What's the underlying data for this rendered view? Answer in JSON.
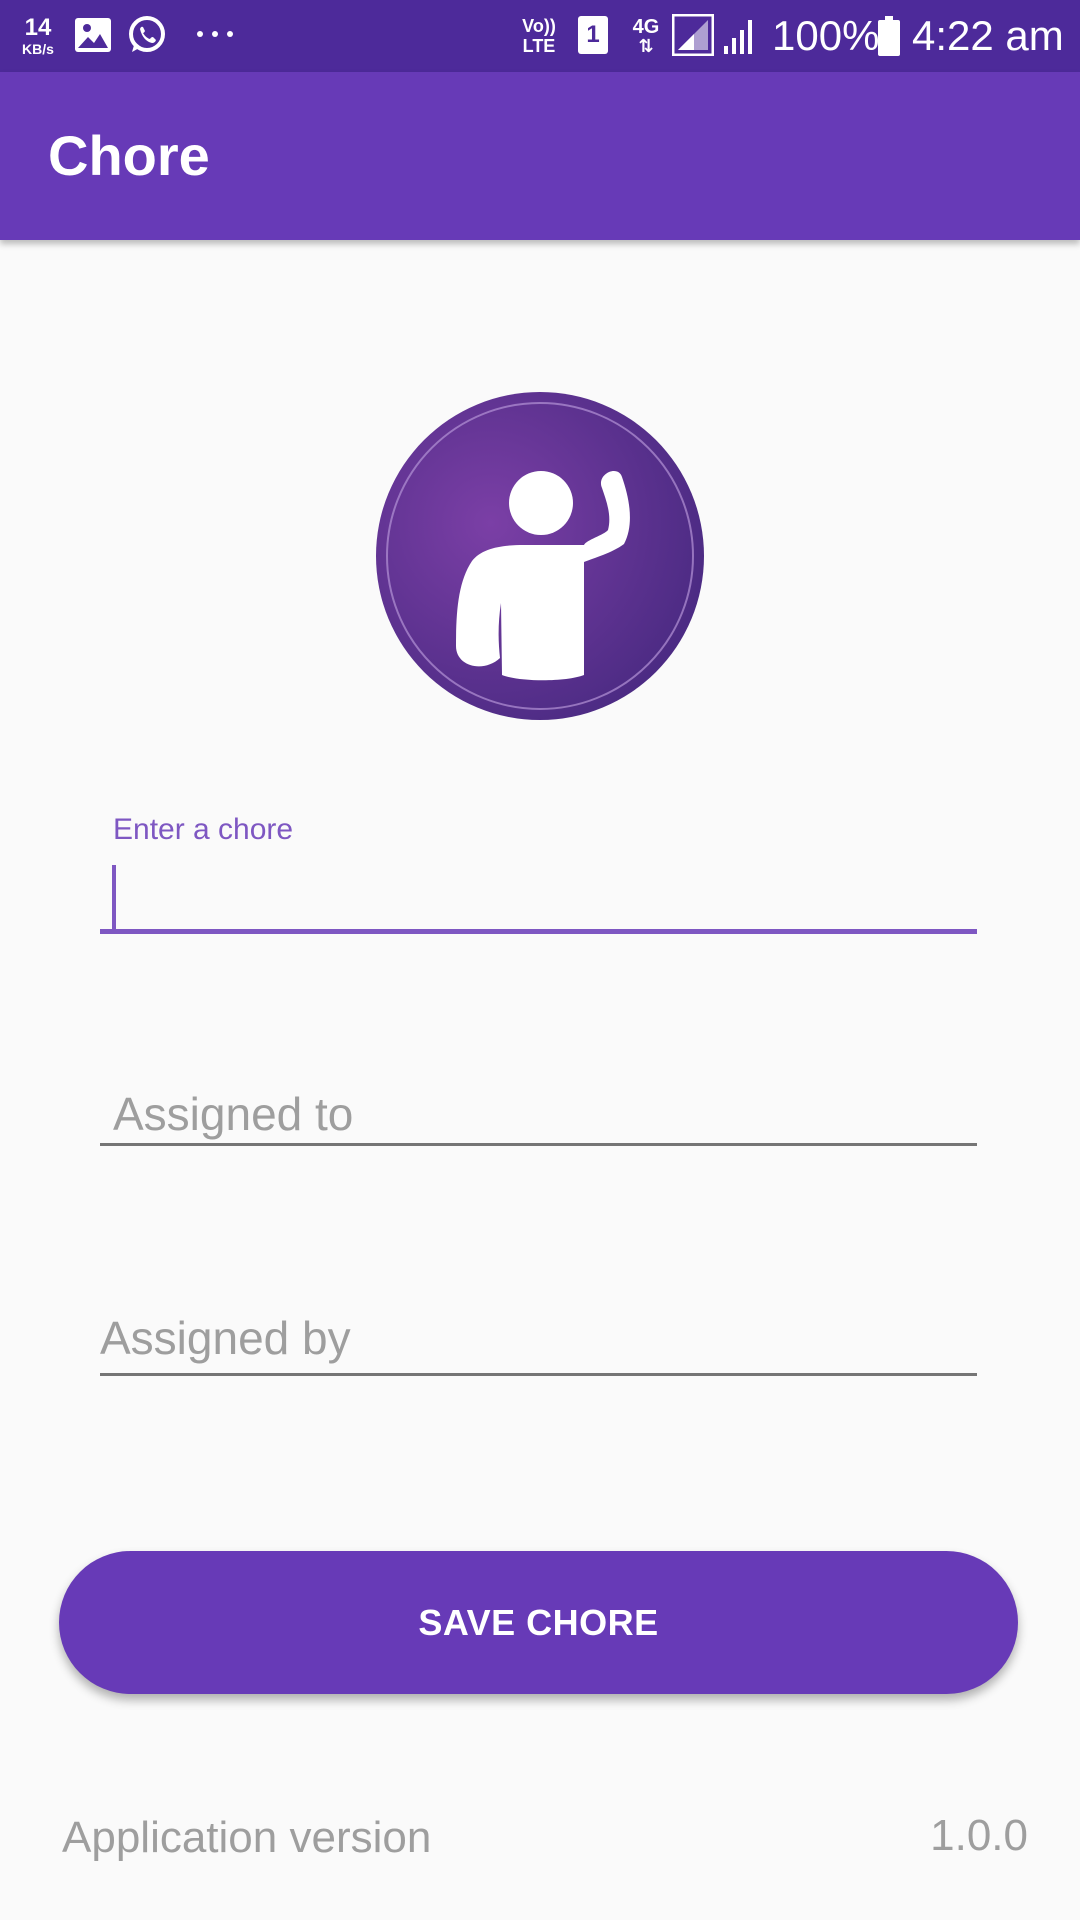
{
  "status_bar": {
    "net_speed_value": "14",
    "net_speed_unit": "KB/s",
    "volte_top": "Vo))",
    "volte_bottom": "LTE",
    "sim_slot": "1",
    "network_type": "4G",
    "battery_percent": "100%",
    "time": "4:22 am",
    "icons": [
      "gallery-icon",
      "whatsapp-icon",
      "more-notifications-icon",
      "volte-icon",
      "sim-icon",
      "data-arrows-icon",
      "signal-icon",
      "battery-icon"
    ]
  },
  "app_bar": {
    "title": "Chore",
    "color": "#673ab7"
  },
  "avatar": {
    "icon": "person-waving-icon",
    "color": "#5e2d8c"
  },
  "form": {
    "chore_label": "Enter a chore",
    "chore_value": "",
    "assigned_to_placeholder": "Assigned to",
    "assigned_by_placeholder": "Assigned by"
  },
  "button": {
    "save_label": "SAVE CHORE"
  },
  "footer": {
    "version_label": "Application version",
    "version_value": "1.0.0"
  },
  "colors": {
    "status_bar": "#4d2a9a",
    "accent": "#7e57c2",
    "background": "#fafafa"
  }
}
